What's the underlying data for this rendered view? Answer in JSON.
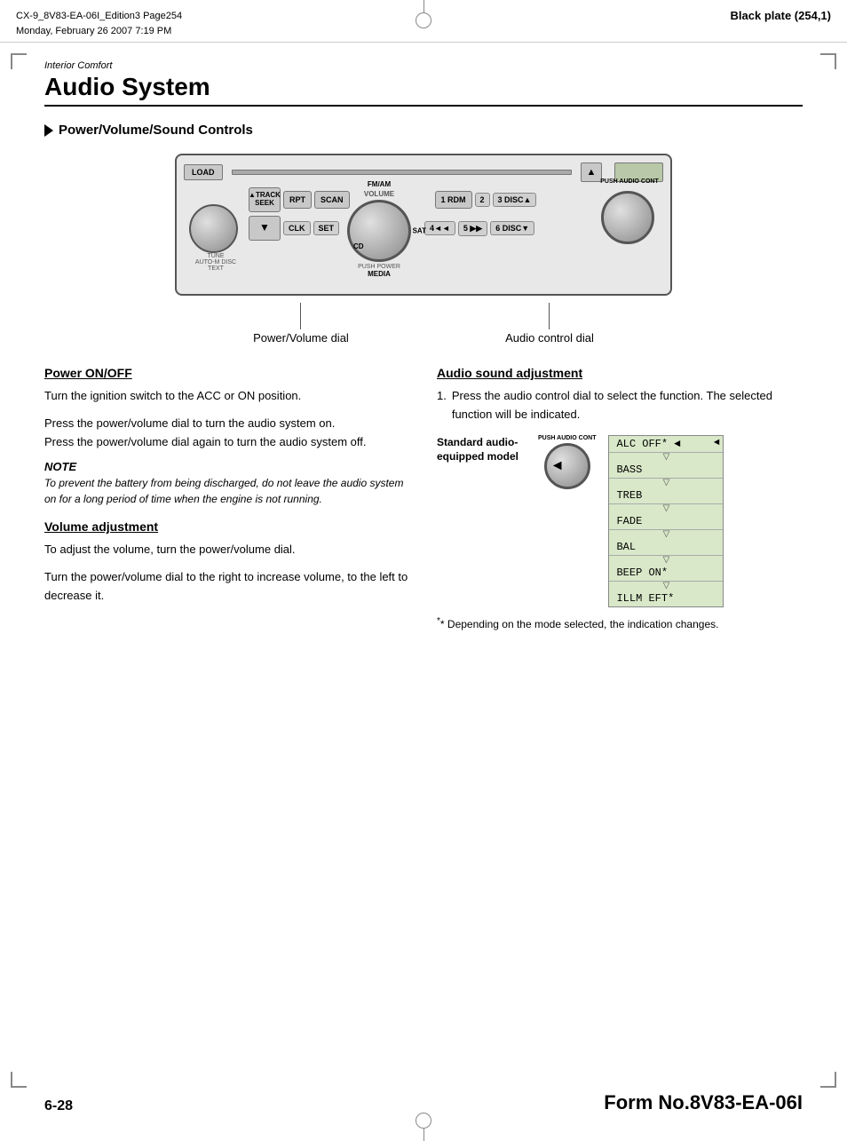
{
  "header": {
    "left_line1": "CX-9_8V83-EA-06I_Edition3 Page254",
    "left_line2": "Monday, February 26 2007 7:19 PM",
    "right": "Black plate (254,1)"
  },
  "section": {
    "label": "Interior Comfort",
    "title": "Audio System"
  },
  "subsection": {
    "heading": "Power/Volume/Sound Controls"
  },
  "diagram": {
    "label_left": "Power/Volume dial",
    "label_right": "Audio control dial"
  },
  "audio_unit": {
    "load_btn": "LOAD",
    "track_seek_btn": "TRACK\nSEEK",
    "rpt_btn": "RPT",
    "scan_btn": "SCAN",
    "rdm_btn": "1 RDM",
    "disc2_btn": "2",
    "disc3_btn": "3 DISC▲",
    "v_btn": "▼",
    "clk_btn": "CLK",
    "set_btn": "SET",
    "disc4_btn": "4◄◄",
    "disc5_btn": "5 ▶▶",
    "disc6_btn": "6 DISC▼",
    "fmam_label": "FM/AM",
    "volume_label": "VOLUME",
    "cd_label": "CD",
    "sat_label": "SAT",
    "push_power_label": "PUSH POWER",
    "media_label": "MEDIA",
    "text_label": "TEXT",
    "tune_label": "TUNE",
    "auto_m_label": "AUTO-M DISC",
    "right_dial_label": "PUSH AUDIO CONT"
  },
  "left_column": {
    "power_heading": "Power ON/OFF",
    "power_para1": "Turn the ignition switch to the ACC or ON position.",
    "power_para2": "Press the power/volume dial to turn the audio system on.\nPress the power/volume dial again to turn the audio system off.",
    "note_heading": "NOTE",
    "note_text": "To prevent the battery from being discharged, do not leave the audio system on for a long period of time when the engine is not running.",
    "volume_heading": "Volume adjustment",
    "volume_para1": "To adjust the volume, turn the power/volume dial.",
    "volume_para2": "Turn the power/volume dial to the right to increase volume, to the left to decrease it."
  },
  "right_column": {
    "audio_heading": "Audio sound adjustment",
    "audio_para1": "1.  Press the audio control dial to select the function. The selected function will be indicated.",
    "standard_label": "Standard audio-equipped model",
    "dial_label": "PUSH AUDIO CONT",
    "menu_items": [
      {
        "text": "ALC OFF*",
        "selected": true
      },
      {
        "text": "BASS",
        "selected": false
      },
      {
        "text": "TREB",
        "selected": false
      },
      {
        "text": "FADE",
        "selected": false
      },
      {
        "text": "BAL",
        "selected": false
      },
      {
        "text": "BEEP ON*",
        "selected": false
      },
      {
        "text": "ILLM EFT*",
        "selected": false
      }
    ],
    "footnote": "* Depending on the mode selected, the indication changes."
  },
  "footer": {
    "page_number": "6-28",
    "form_number": "Form No.8V83-EA-06I"
  }
}
